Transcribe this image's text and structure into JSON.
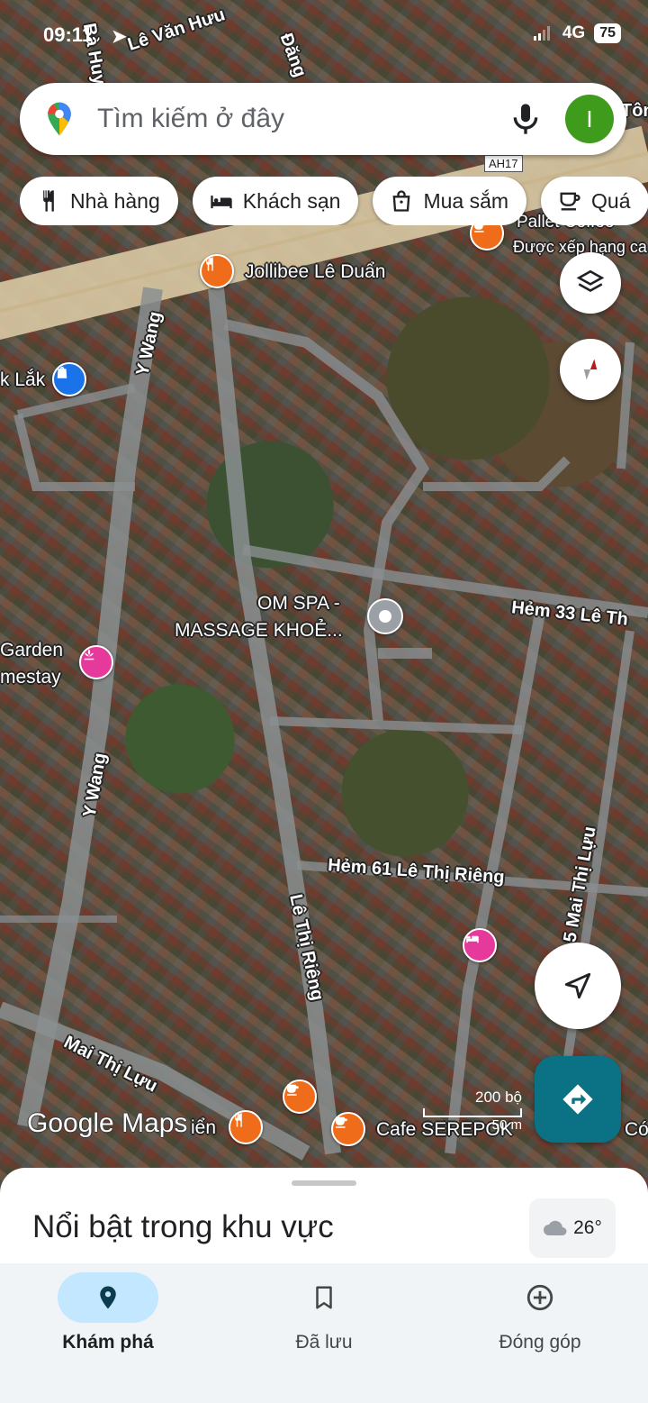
{
  "status_bar": {
    "time": "09:11",
    "network": "4G",
    "battery": "75"
  },
  "search": {
    "placeholder": "Tìm kiếm ở đây",
    "avatar_initial": "I",
    "logo": "google-maps-pin-icon",
    "mic": "microphone-icon"
  },
  "chips": [
    {
      "label": "Nhà hàng",
      "icon": "restaurant-icon"
    },
    {
      "label": "Khách sạn",
      "icon": "hotel-icon"
    },
    {
      "label": "Mua sắm",
      "icon": "shopping-bag-icon"
    },
    {
      "label": "Quá",
      "icon": "coffee-icon"
    }
  ],
  "map": {
    "streets": [
      "Lê Văn Hưu",
      "Bà Huyện",
      "Y Wang",
      "Y Wang",
      "Hẻm 33 Lê Th",
      "Hẻm 61 Lê Thị Riêng",
      "Lê Thị Riêng",
      "Mai Thị Lựu",
      "5 Mai Thị Lựu",
      "Đăng",
      "Tôn",
      "AH17"
    ],
    "places": {
      "jollibee": "Jollibee Lê Duẩn",
      "pallet": "Pallet Coffee",
      "pallet_sub": "Được xếp hạng ca",
      "daklak": "k Lắk",
      "om_spa_1": "OM SPA -",
      "om_spa_2": "MASSAGE KHOẺ...",
      "garden_1": "Garden",
      "garden_2": "mestay",
      "cafe_serepok": "Cafe SEREPOK",
      "bien": "iển",
      "co": "Có"
    },
    "watermark": "Google Maps",
    "scale_top": "200 bộ",
    "scale_bottom": "50 m"
  },
  "buttons": {
    "layers": "layers-icon",
    "compass": "compass-icon",
    "my_location": "navigation-arrow-icon",
    "directions": "directions-icon"
  },
  "sheet": {
    "title": "Nổi bật trong khu vực",
    "weather": "26°"
  },
  "nav": [
    {
      "label": "Khám phá",
      "icon": "location-pin-icon",
      "active": true
    },
    {
      "label": "Đã lưu",
      "icon": "bookmark-icon",
      "active": false
    },
    {
      "label": "Đóng góp",
      "icon": "add-circle-icon",
      "active": false
    }
  ]
}
